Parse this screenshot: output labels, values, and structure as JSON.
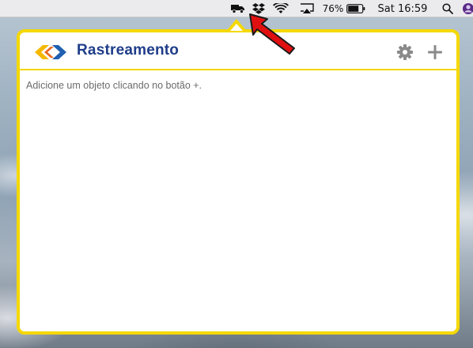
{
  "menubar": {
    "battery_percent": "76%",
    "clock": "Sat 16:59",
    "status_icons": [
      "truck-icon",
      "dropbox-icon",
      "wifi-icon",
      "airplay-icon",
      "battery-icon",
      "spotlight-search-icon",
      "user-avatar-icon"
    ]
  },
  "popover": {
    "title": "Rastreamento",
    "empty_message": "Adicione um objeto clicando no botão +.",
    "actions": [
      "gear-icon",
      "plus-icon"
    ],
    "colors": {
      "border": "#f5d800",
      "title": "#1f3d8a",
      "logo_yellow": "#f5b800",
      "logo_blue": "#1f5fb0"
    }
  },
  "annotation": {
    "type": "red-arrow",
    "color": "#e01010",
    "points_to": "truck-icon"
  }
}
